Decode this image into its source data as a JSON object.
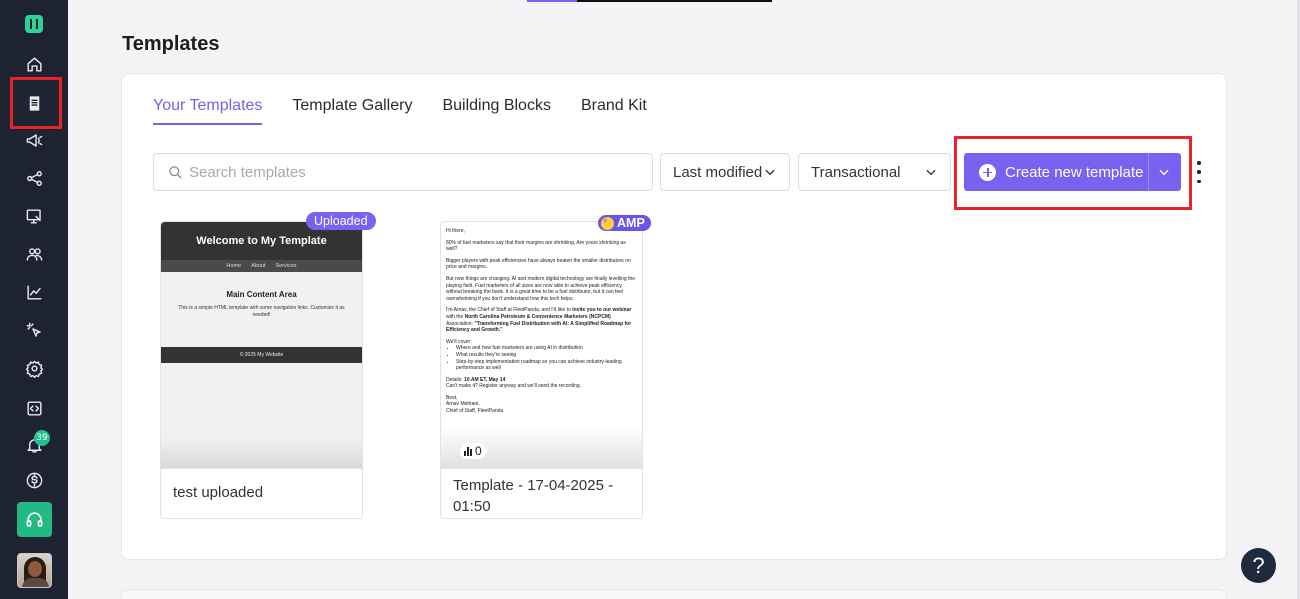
{
  "page": {
    "title": "Templates"
  },
  "sidebar": {
    "items": [
      {
        "icon": "home-icon"
      },
      {
        "icon": "templates-icon"
      },
      {
        "icon": "campaign-icon"
      },
      {
        "icon": "workflow-icon"
      },
      {
        "icon": "monitor-icon"
      },
      {
        "icon": "contacts-icon"
      },
      {
        "icon": "analytics-icon"
      },
      {
        "icon": "click-icon"
      },
      {
        "icon": "settings-icon"
      },
      {
        "icon": "code-icon"
      },
      {
        "icon": "bell-icon"
      },
      {
        "icon": "dollar-icon"
      }
    ],
    "notification_count": "39",
    "support_icon": "headset-icon"
  },
  "tabs": [
    {
      "label": "Your Templates",
      "active": true
    },
    {
      "label": "Template Gallery"
    },
    {
      "label": "Building Blocks"
    },
    {
      "label": "Brand Kit"
    }
  ],
  "toolbar": {
    "search_placeholder": "Search templates",
    "sort_value": "Last modified",
    "type_value": "Transactional",
    "create_label": "Create new template"
  },
  "templates": [
    {
      "name": "test uploaded",
      "badge": "Uploaded",
      "preview": {
        "header": "Welcome to My Template",
        "nav": [
          "Home",
          "About",
          "Services"
        ],
        "heading": "Main Content Area",
        "text": "This is a simple HTML template with some navigation links. Customize it as needed!",
        "footer": "© 2025 My Website"
      }
    },
    {
      "name": "Template - 17-04-2025 - 01:50",
      "badge": "AMP",
      "stat": "0",
      "preview": {
        "greeting": "Hi there,",
        "p1": "80% of fuel marketers say that their margins are shrinking. Are yours shrinking as well?",
        "p2": "Bigger players with peak efficiencies have always beaten the smaller distributors on price and margins.",
        "p3": "But now things are changing. AI and modern digital technology are finally levelling the playing field. Fuel marketers of all sizes are now able to achieve peak efficiency without breaking the bank. It is a great time to be a fuel distributor, but it can feel overwhelming if you don't understand how this tech helps.",
        "p4a": "I'm Arnav, the Chief of Staff at FleetPanda, and I'd like to ",
        "p4b": "invite you to our webinar",
        "p4c": " with the ",
        "p4d": "North Carolina Petroleum & Convenience Marketers (NCPCM)",
        "p4e": " Association: ",
        "p4f": "\"Transforming Fuel Distribution with AI: A Simplified Roadmap for Efficiency and Growth.\"",
        "cover": "We'll cover:",
        "bullets": [
          "Where and how fuel marketers are using AI in distribution",
          "What results they're seeing",
          "Step-by-step implementation roadmap so you can achieve industry-leading performance as well"
        ],
        "details_label": "Details: ",
        "details_value": "10 AM ET, May 14",
        "details_note": "Can't make it? Register anyway and we'll send the recording.",
        "signoff": "Best,",
        "sig_name": "Arnav Mehtani,",
        "sig_title": "Chief of Staff, FleetPanda"
      }
    }
  ]
}
